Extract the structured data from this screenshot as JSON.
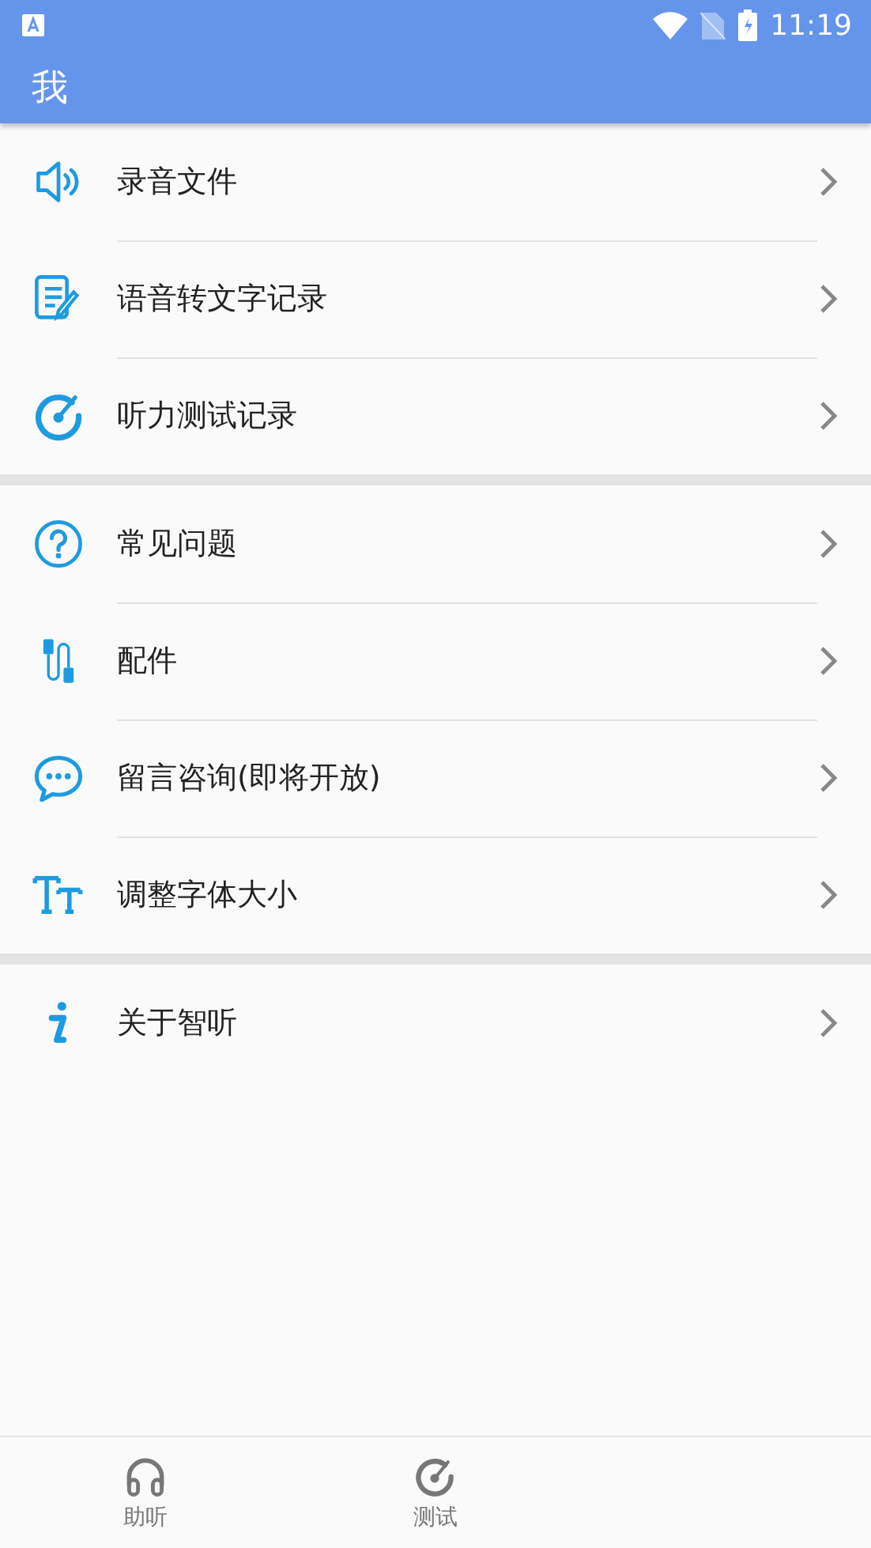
{
  "status_bar": {
    "time": "11:19"
  },
  "app_bar": {
    "title": "我"
  },
  "sections": [
    {
      "items": [
        {
          "label": "录音文件"
        },
        {
          "label": "语音转文字记录"
        },
        {
          "label": "听力测试记录"
        }
      ]
    },
    {
      "items": [
        {
          "label": "常见问题"
        },
        {
          "label": "配件"
        },
        {
          "label": "留言咨询(即将开放)"
        },
        {
          "label": "调整字体大小"
        }
      ]
    },
    {
      "items": [
        {
          "label": "关于智听"
        }
      ]
    }
  ],
  "bottom_nav": [
    {
      "label": "助听",
      "selected": false
    },
    {
      "label": "测试",
      "selected": false
    }
  ]
}
